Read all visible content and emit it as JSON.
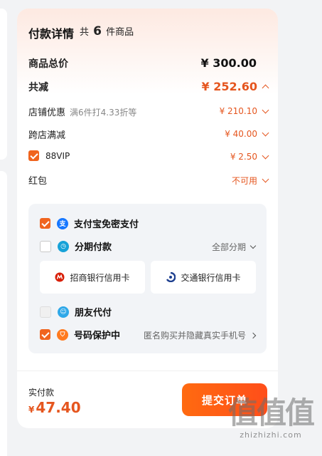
{
  "header": {
    "title": "付款详情",
    "count_prefix": "共",
    "count": "6",
    "count_suffix": "件商品"
  },
  "rows": {
    "total": {
      "label": "商品总价",
      "value": "¥ 300.00"
    },
    "discount": {
      "label": "共减",
      "value": "¥ 252.60"
    },
    "shop": {
      "label": "店铺优惠",
      "note": "满6件打4.33折等",
      "value": "¥ 210.10"
    },
    "cross": {
      "label": "跨店满减",
      "value": "¥ 40.00"
    },
    "vip": {
      "label": "88VIP",
      "value": "¥ 2.50",
      "checked": true
    },
    "redpacket": {
      "label": "红包",
      "value": "不可用"
    }
  },
  "payment": {
    "alipay": {
      "label": "支付宝免密支付",
      "icon": "alipay-icon",
      "checked": true
    },
    "installment": {
      "label": "分期付款",
      "icon": "installment-icon",
      "right": "全部分期",
      "checked": false
    },
    "banks": [
      {
        "label": "招商银行信用卡",
        "icon": "cmb-icon"
      },
      {
        "label": "交通银行信用卡",
        "icon": "bocom-icon"
      }
    ],
    "friend": {
      "label": "朋友代付",
      "icon": "friend-icon",
      "disabled": true
    },
    "privacy": {
      "label": "号码保护中",
      "icon": "shield-icon",
      "right": "匿名购买并隐藏真实手机号",
      "checked": true
    }
  },
  "footer": {
    "paid_label": "实付款",
    "currency": "¥",
    "amount": "47.40",
    "submit_label": "提交订单"
  },
  "watermark": {
    "chars": "值值值",
    "url": "zhizhizhi.com"
  },
  "colors": {
    "accent": "#f0641e",
    "price": "#e5561f",
    "alipay": "#1677ff",
    "installment": "#17a2d8"
  }
}
